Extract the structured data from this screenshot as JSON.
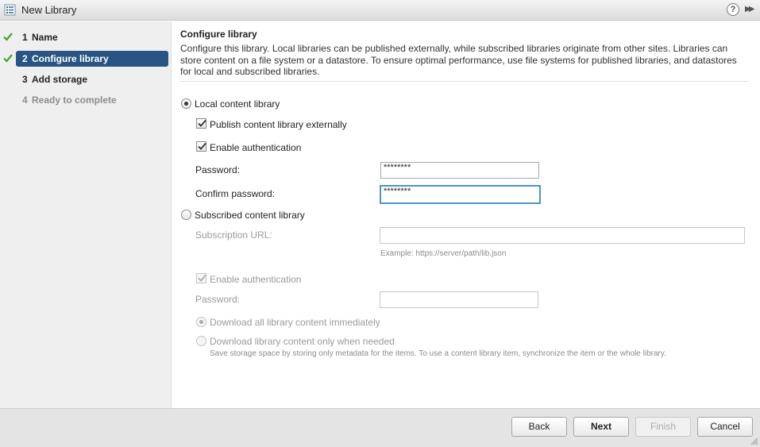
{
  "window": {
    "title": "New Library",
    "help": "?",
    "expand": "▶▶"
  },
  "nav": {
    "items": [
      {
        "num": "1",
        "label": "Name",
        "state": "done"
      },
      {
        "num": "2",
        "label": "Configure library",
        "state": "active"
      },
      {
        "num": "3",
        "label": "Add storage",
        "state": "normal"
      },
      {
        "num": "4",
        "label": "Ready to complete",
        "state": "disabled"
      }
    ]
  },
  "main": {
    "heading": "Configure library",
    "description": "Configure this library. Local libraries can be published externally, while subscribed libraries originate from other sites. Libraries can store content on a file system or a datastore. To ensure optimal performance, use file systems for published libraries, and datastores for local and subscribed libraries.",
    "local": {
      "label": "Local content library",
      "publish_label": "Publish content library externally",
      "auth_label": "Enable authentication",
      "password_label": "Password:",
      "password_value": "********",
      "confirm_label": "Confirm password:",
      "confirm_value": "********"
    },
    "subscribed": {
      "label": "Subscribed content library",
      "url_label": "Subscription URL:",
      "url_value": "",
      "url_hint": "Example: https://server/path/lib.json",
      "auth_label": "Enable authentication",
      "password_label": "Password:",
      "password_value": "",
      "download_all_label": "Download all library content immediately",
      "download_needed_label": "Download library content only when needed",
      "download_needed_hint": "Save storage space by storing only metadata for the items. To use a content library item, synchronize the item or the whole library."
    }
  },
  "footer": {
    "back": "Back",
    "next": "Next",
    "finish": "Finish",
    "cancel": "Cancel"
  },
  "colors": {
    "accent": "#285583",
    "check": "#4aa02c",
    "focus": "#4c96c4"
  }
}
